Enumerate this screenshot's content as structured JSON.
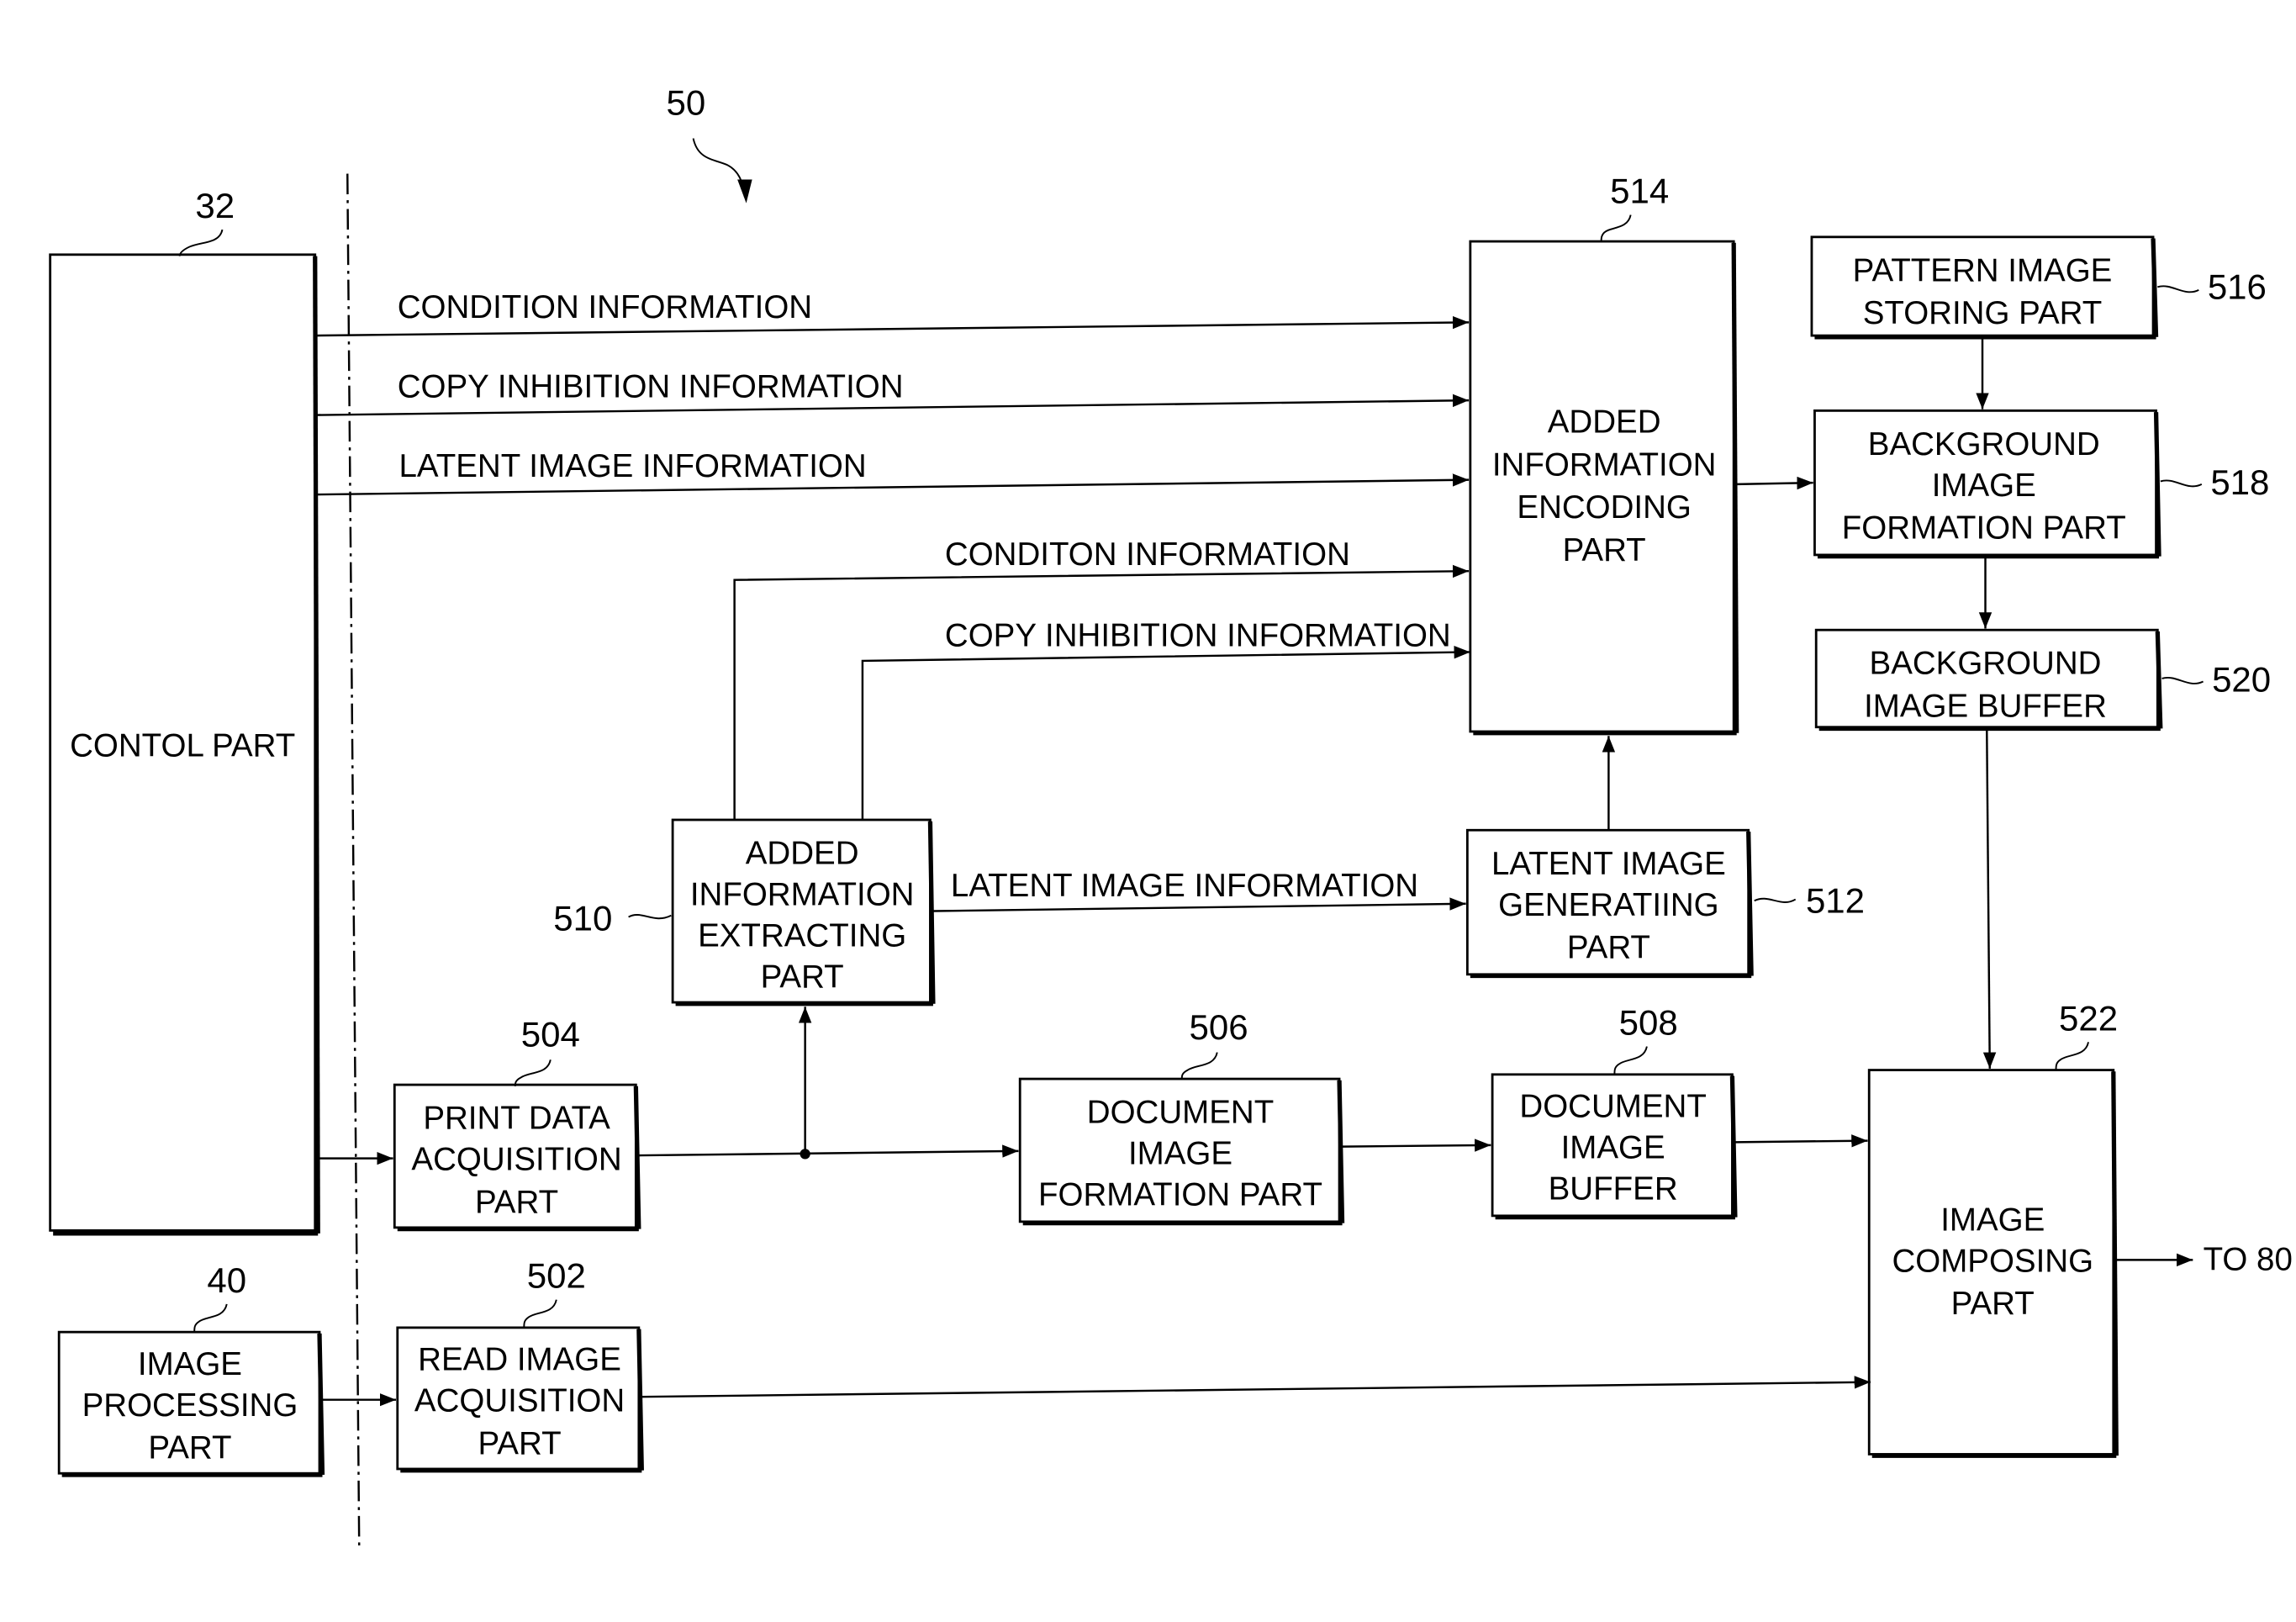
{
  "figure": {
    "ref_number": "50"
  },
  "blocks": {
    "control_part": {
      "ref": "32",
      "lines": [
        "CONTOL PART"
      ]
    },
    "image_processing_part": {
      "ref": "40",
      "lines": [
        "IMAGE",
        "PROCESSING",
        "PART"
      ]
    },
    "read_image_acquisition_part": {
      "ref": "502",
      "lines": [
        "READ IMAGE",
        "ACQUISITION",
        "PART"
      ]
    },
    "print_data_acquisition_part": {
      "ref": "504",
      "lines": [
        "PRINT DATA",
        "ACQUISITION",
        "PART"
      ]
    },
    "document_image_formation_part": {
      "ref": "506",
      "lines": [
        "DOCUMENT",
        "IMAGE",
        "FORMATION PART"
      ]
    },
    "document_image_buffer": {
      "ref": "508",
      "lines": [
        "DOCUMENT",
        "IMAGE",
        "BUFFER"
      ]
    },
    "added_information_extracting_part": {
      "ref": "510",
      "lines": [
        "ADDED",
        "INFORMATION",
        "EXTRACTING",
        "PART"
      ]
    },
    "latent_image_generating_part": {
      "ref": "512",
      "lines": [
        "LATENT IMAGE",
        "GENERATIING",
        "PART"
      ]
    },
    "added_information_encoding_part": {
      "ref": "514",
      "lines": [
        "ADDED",
        "INFORMATION",
        "ENCODING",
        "PART"
      ]
    },
    "pattern_image_storing_part": {
      "ref": "516",
      "lines": [
        "PATTERN IMAGE",
        "STORING PART"
      ]
    },
    "background_image_formation_part": {
      "ref": "518",
      "lines": [
        "BACKGROUND",
        "IMAGE",
        "FORMATION PART"
      ]
    },
    "background_image_buffer": {
      "ref": "520",
      "lines": [
        "BACKGROUND",
        "IMAGE BUFFER"
      ]
    },
    "image_composing_part": {
      "ref": "522",
      "lines": [
        "IMAGE",
        "COMPOSING",
        "PART"
      ]
    }
  },
  "flows": {
    "control_condition": "CONDITION INFORMATION",
    "control_copy_inhibition": "COPY INHIBITION INFORMATION",
    "control_latent_image": "LATENT IMAGE INFORMATION",
    "extract_condition": "CONDITON INFORMATION",
    "extract_copy_inhibition": "COPY INHIBITION INFORMATION",
    "extract_latent_image": "LATENT IMAGE INFORMATION",
    "output": "TO 80"
  }
}
